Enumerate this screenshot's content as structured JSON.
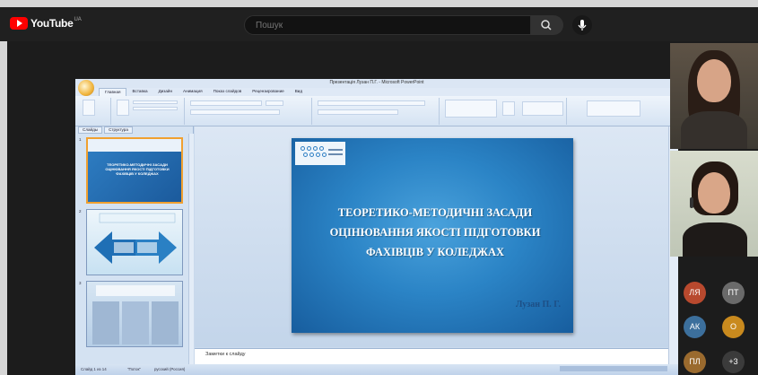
{
  "youtube": {
    "brand": "YouTube",
    "brand_sup": "UA",
    "search_placeholder": "Пошук",
    "icons": {
      "search": "search-icon",
      "mic": "mic-icon",
      "logo": "youtube-logo-icon"
    },
    "colors": {
      "bar": "#202020",
      "logo_red": "#ff0000"
    }
  },
  "powerpoint": {
    "window_title": "Презентація Лузан П.Г. - Microsoft PowerPoint",
    "tabs": [
      "Главная",
      "Вставка",
      "Дизайн",
      "Анимация",
      "Показ слайдов",
      "Рецензирование",
      "Вид"
    ],
    "active_tab": "Главная",
    "left_tabs": [
      "Слайды",
      "Структура"
    ],
    "thumbnail_numbers": [
      "1",
      "2",
      "3"
    ],
    "notes_placeholder": "Заметки к слайду",
    "status_slide": "Слайд 1 из 14",
    "status_theme": "\"Поток\"",
    "status_lang": "русский (Россия)",
    "slide": {
      "title_lines": [
        "ТЕОРЕТИКО-МЕТОДИЧНІ ЗАСАДИ",
        "ОЦІНЮВАННЯ ЯКОСТІ ПІДГОТОВКИ",
        "ФАХІВЦІВ У КОЛЕДЖАХ"
      ],
      "author": "Лузан П. Г."
    },
    "colors": {
      "slide_blue": "#2b84c6",
      "thumb_selected": "#f0a030"
    }
  },
  "participants": {
    "avatars": [
      {
        "initials": "ЛЯ",
        "color": "#b8492e"
      },
      {
        "initials": "ПТ",
        "color": "#6a6a6a"
      },
      {
        "initials": "АК",
        "color": "#3c6f9c"
      },
      {
        "initials": "О",
        "color": "#c98a1e"
      },
      {
        "initials": "ПЛ",
        "color": "#9a6a2e"
      },
      {
        "initials": "+3",
        "color": "#3b3b3b"
      }
    ]
  }
}
